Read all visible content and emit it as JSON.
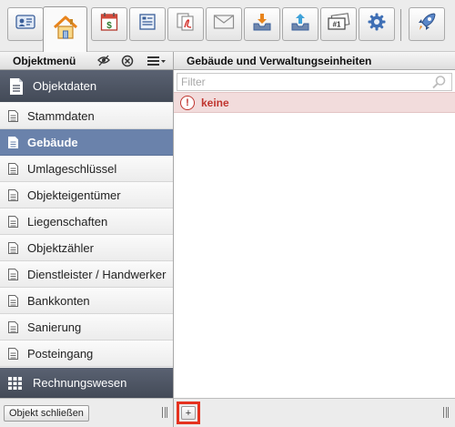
{
  "toolbar": {
    "buttons": [
      {
        "name": "contact-card-icon"
      },
      {
        "name": "home-icon",
        "active": true
      },
      {
        "name": "calendar-dollar-icon"
      },
      {
        "name": "form-icon"
      },
      {
        "name": "pdf-documents-icon"
      },
      {
        "name": "envelope-icon"
      },
      {
        "name": "tray-download-icon"
      },
      {
        "name": "tray-upload-icon"
      },
      {
        "name": "tickets-icon",
        "text": "#1"
      },
      {
        "name": "gear-icon"
      },
      {
        "name": "rocket-icon"
      }
    ]
  },
  "left_header": {
    "title": "Objektmenü"
  },
  "right_header": {
    "title": "Gebäude und Verwaltungseinheiten"
  },
  "sidebar": {
    "section_top": "Objektdaten",
    "items": [
      {
        "label": "Stammdaten"
      },
      {
        "label": "Gebäude",
        "selected": true
      },
      {
        "label": "Umlageschlüssel"
      },
      {
        "label": "Objekteigentümer"
      },
      {
        "label": "Liegenschaften"
      },
      {
        "label": "Objektzähler"
      },
      {
        "label": "Dienstleister / Handwerker"
      },
      {
        "label": "Bankkonten"
      },
      {
        "label": "Sanierung"
      },
      {
        "label": "Posteingang"
      }
    ],
    "section_bottom": "Rechnungswesen"
  },
  "main": {
    "filter_placeholder": "Filter",
    "empty_row": "keine"
  },
  "footer": {
    "close_object_label": "Objekt schließen",
    "add_label": "+"
  },
  "colors": {
    "accent_selected": "#6a82ab",
    "section_header": "#4d5463",
    "warning_red": "#c0352f",
    "warning_bg": "#f2dcdc",
    "highlight_border": "#e5321f"
  }
}
